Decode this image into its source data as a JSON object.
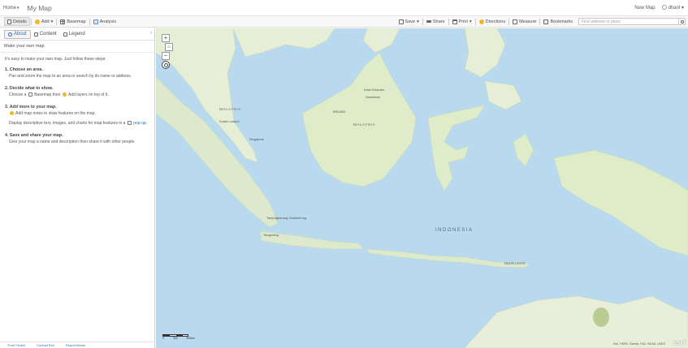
{
  "topbar": {
    "home_label": "Home",
    "map_title": "My Map",
    "new_map_label": "New Map",
    "user_label": "dhanl"
  },
  "toolbar": {
    "details": "Details",
    "add": "Add",
    "basemap": "Basemap",
    "analysis": "Analysis",
    "save": "Save",
    "share": "Share",
    "print": "Print",
    "directions": "Directions",
    "measure": "Measure",
    "bookmarks": "Bookmarks",
    "search_placeholder": "Find address or place"
  },
  "sidebar": {
    "tabs": [
      {
        "label": "About"
      },
      {
        "label": "Content"
      },
      {
        "label": "Legend"
      }
    ],
    "heading": "Make your own map",
    "intro": "It's easy to make your own map. Just follow these steps:",
    "steps": [
      {
        "title": "1. Choose an area.",
        "text": "Pan and zoom the map to an area or search by its name or address."
      },
      {
        "title": "2. Decide what to show.",
        "text_a": "Choose a",
        "text_b": "Basemap then",
        "text_c": "Add layers on top of it."
      },
      {
        "title": "3. Add more to your map.",
        "text_a": "Add map notes to draw features on the map.",
        "text_b": "Display descriptive text, images, and charts for map features in a",
        "text_c": "pop-up."
      },
      {
        "title": "4. Save and share your map.",
        "text": "Give your map a name and description then share it with other people."
      }
    ],
    "footer": {
      "trust": "Trust Center",
      "contact": "Contact Esri",
      "abuse": "Report Abuse"
    }
  },
  "map": {
    "labels": {
      "malaysia_w": "MALAYSIA",
      "malaysia_e": "MALAYSIA",
      "indonesia": "INDONESIA",
      "brunei": "BRUNEI",
      "singapore": "Singapore",
      "kuala_lumpur": "Kuala Lumpur",
      "kota_kinabalu": "Kota Kinabalu",
      "tangerang": "Tangerang",
      "tanjungkarang": "Tanjungkarang-Telukbetung",
      "timor_leste": "TIMOR-LESTE",
      "sandakan": "Sandakan"
    },
    "scale_labels": [
      "0",
      "300",
      "600km"
    ],
    "attribution": "Esri, HERE, Garmin, FAO, NOAA, USGS",
    "logo": "esri",
    "colors": {
      "water": "#b9d9ee",
      "land": "#e6efd6",
      "forest": "#cfe3b8"
    }
  }
}
